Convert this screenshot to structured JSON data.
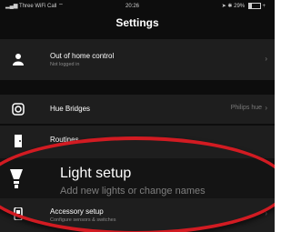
{
  "status_bar": {
    "carrier": "Three WiFi Call",
    "time": "20:26",
    "battery_percent": "29%",
    "battery_level": 0.29
  },
  "header": {
    "title": "Settings"
  },
  "rows": {
    "out_of_home": {
      "label": "Out of home control",
      "sub": "Not logged in",
      "icon": "person-icon"
    },
    "hue_bridges": {
      "label": "Hue Bridges",
      "value": "Philips hue",
      "icon": "bridge-icon"
    },
    "routines": {
      "label": "Routines",
      "icon": "door-icon"
    },
    "light_setup": {
      "label": "Light setup",
      "sub": "Add new lights or change names",
      "icon": "lightbulb-icon"
    },
    "accessory_setup": {
      "label": "Accessory setup",
      "sub": "Configure sensors & switches",
      "icon": "switch-icon"
    }
  },
  "colors": {
    "highlight": "#d21b22",
    "background": "#0d0d0d",
    "row": "#1e1e1e"
  }
}
